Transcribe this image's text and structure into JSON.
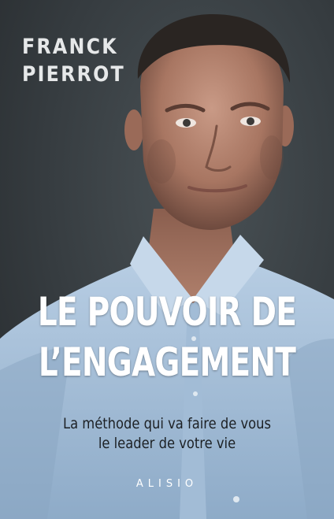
{
  "cover": {
    "author_first": "FRANCK",
    "author_last": "PIERROT",
    "title_line1": "LE POUVOIR DE",
    "title_line2": "L’ENGAGEMENT",
    "subtitle_line1": "La méthode qui va faire de vous",
    "subtitle_line2": "le leader de votre vie",
    "publisher": "ALISIO"
  },
  "colors": {
    "background": "#363c40",
    "author_text": "#e6e8e9",
    "title_text": "#ffffff",
    "subtitle_text": "#1c2024",
    "shirt": "#a9c3dc"
  }
}
